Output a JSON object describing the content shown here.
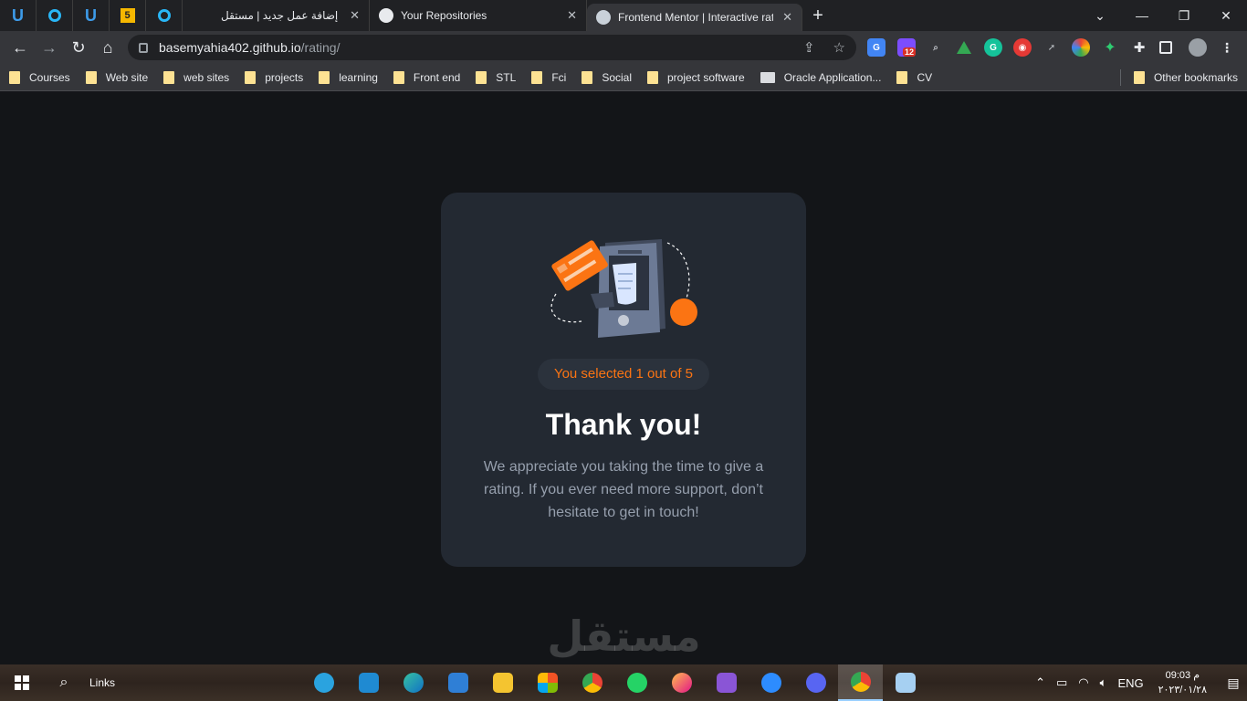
{
  "browser": {
    "tabs": [
      {
        "label": "إضافة عمل جديد | مستقل",
        "active": false
      },
      {
        "label": "Your Repositories",
        "active": false
      },
      {
        "label": "Frontend Mentor | Interactive rat",
        "active": true
      }
    ],
    "pinned_tabs": [
      "U",
      "",
      "U",
      "5",
      ""
    ],
    "address": {
      "host": "basemyahia402.github.io",
      "path": "/rating/"
    },
    "extension_badge": "12",
    "bookmarks": [
      "Courses",
      "Web site",
      "web sites",
      "projects",
      "learning",
      "Front end",
      "STL",
      "Fci",
      "Social",
      "project software",
      "Oracle Application...",
      "CV"
    ],
    "other_bookmarks": "Other bookmarks"
  },
  "card": {
    "selected_text": "You selected 1 out of 5",
    "title": "Thank you!",
    "description": "We appreciate you taking the time to give a rating. If you ever need more support, don’t hesitate to get in touch!"
  },
  "watermark": "مستقل",
  "taskbar": {
    "links_label": "Links",
    "language": "ENG",
    "time": "09:03 م",
    "date": "٢٠٢٣/٠١/٢٨"
  },
  "colors": {
    "accent": "#fb7413",
    "card_bg": "#232932",
    "page_bg": "#131518"
  }
}
